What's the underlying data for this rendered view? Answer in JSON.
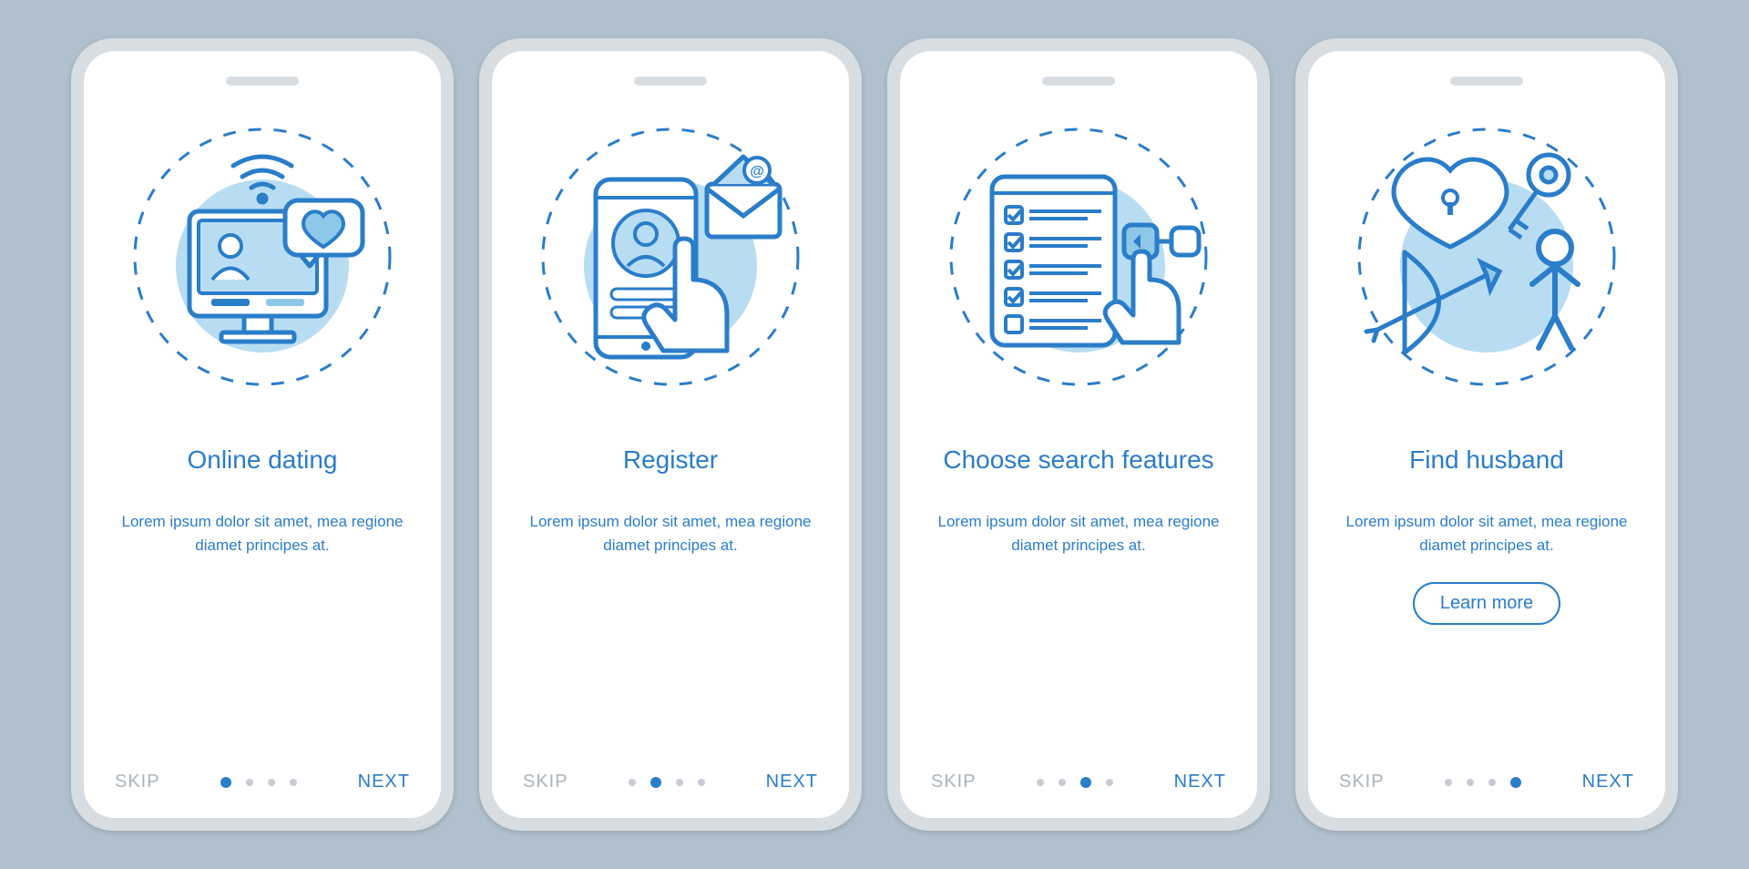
{
  "colors": {
    "accent": "#2a7dc9",
    "accent_light": "#8fc7e8",
    "accent_fill": "#b8ddf2",
    "background": "#b0c0cc",
    "phone_frame": "#d8dde2",
    "muted": "#a9b3bd"
  },
  "common": {
    "skip_label": "SKIP",
    "next_label": "NEXT",
    "learn_more_label": "Learn more"
  },
  "screens": [
    {
      "icon": "monitor-chat-heart-wifi",
      "title": "Online dating",
      "description": "Lorem ipsum dolor sit amet, mea regione diamet principes at.",
      "active_dot": 0,
      "has_learn_more": false
    },
    {
      "icon": "phone-profile-hand-email",
      "title": "Register",
      "description": "Lorem ipsum dolor sit amet, mea regione diamet principes at.",
      "active_dot": 1,
      "has_learn_more": false
    },
    {
      "icon": "checklist-tablet-hand-toggle",
      "title": "Choose search features",
      "description": "Lorem ipsum dolor sit amet, mea regione diamet principes at.",
      "active_dot": 2,
      "has_learn_more": false
    },
    {
      "icon": "heart-lock-key-bow-person",
      "title": "Find husband",
      "description": "Lorem ipsum dolor sit amet, mea regione diamet principes at.",
      "active_dot": 3,
      "has_learn_more": true
    }
  ]
}
